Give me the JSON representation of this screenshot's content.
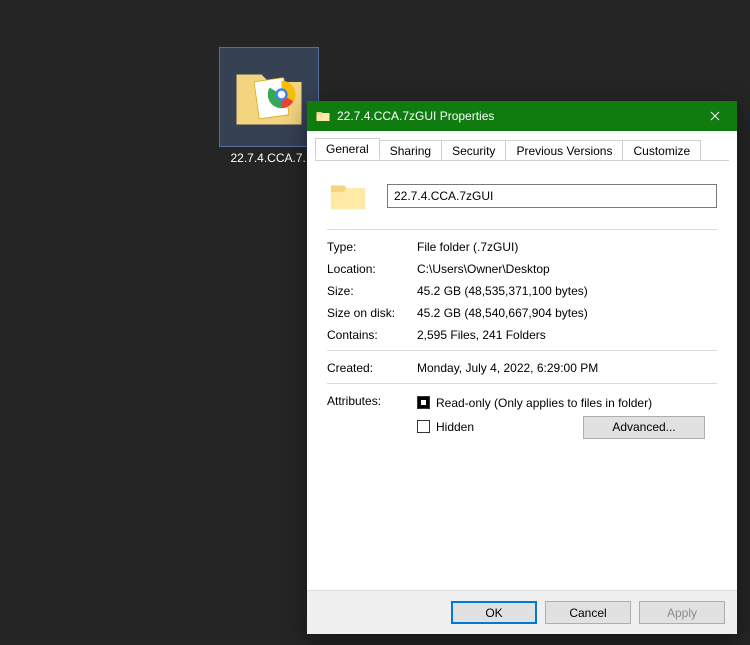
{
  "desktop": {
    "icon_label": "22.7.4.CCA.7..."
  },
  "dialog": {
    "title": "22.7.4.CCA.7zGUI Properties",
    "tabs": [
      "General",
      "Sharing",
      "Security",
      "Previous Versions",
      "Customize"
    ],
    "active_tab": "General",
    "general": {
      "name_value": "22.7.4.CCA.7zGUI",
      "fields": {
        "type_label": "Type:",
        "type_value": "File folder (.7zGUI)",
        "location_label": "Location:",
        "location_value": "C:\\Users\\Owner\\Desktop",
        "size_label": "Size:",
        "size_value": "45.2 GB (48,535,371,100 bytes)",
        "sizeondisk_label": "Size on disk:",
        "sizeondisk_value": "45.2 GB (48,540,667,904 bytes)",
        "contains_label": "Contains:",
        "contains_value": "2,595 Files, 241 Folders",
        "created_label": "Created:",
        "created_value": "Monday, July 4, 2022, 6:29:00 PM",
        "attributes_label": "Attributes:",
        "readonly_label": "Read-only (Only applies to files in folder)",
        "hidden_label": "Hidden",
        "advanced_label": "Advanced..."
      }
    },
    "buttons": {
      "ok": "OK",
      "cancel": "Cancel",
      "apply": "Apply"
    }
  }
}
